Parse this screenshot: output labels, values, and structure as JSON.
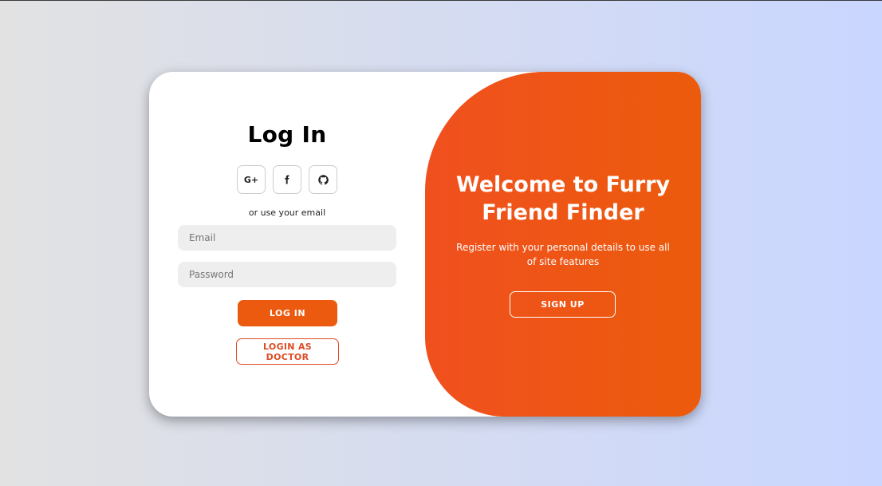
{
  "login": {
    "title": "Log In",
    "social": [
      {
        "icon": "google-plus-icon",
        "label": "G+"
      },
      {
        "icon": "facebook-icon"
      },
      {
        "icon": "github-icon"
      }
    ],
    "divider": "or use your email",
    "email_placeholder": "Email",
    "password_placeholder": "Password",
    "login_button": "LOG IN",
    "doctor_button": "LOGIN AS DOCTOR"
  },
  "toggle": {
    "welcome_line1": "Welcome to Furry",
    "welcome_line2": "Friend Finder",
    "sub_line1": "Register with your personal details to use all",
    "sub_line2": "of site features",
    "signup_button": "SIGN UP"
  },
  "colors": {
    "accent": "#eb5a0e",
    "accent_gradient_start": "#f0501e",
    "doctor_outline": "#e04a22",
    "input_bg": "#eeeeee"
  }
}
